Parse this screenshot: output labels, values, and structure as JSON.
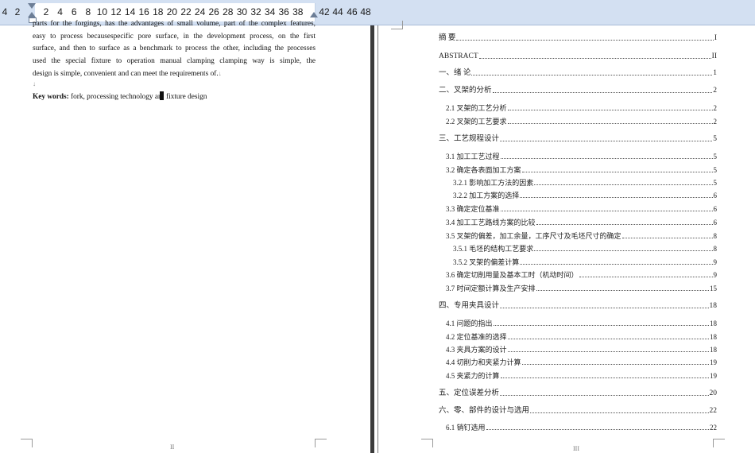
{
  "ruler": {
    "labels_left": [
      "4",
      "2"
    ],
    "labels": [
      "2",
      "4",
      "6",
      "8",
      "10",
      "12",
      "14",
      "16",
      "18",
      "20",
      "22",
      "24",
      "26",
      "28",
      "30",
      "32",
      "34",
      "36",
      "38"
    ],
    "labels_right": [
      "42",
      "44",
      "46",
      "48"
    ]
  },
  "left_page": {
    "abstract_lines": [
      "parts for the forgings, has the advantages of small volume, part of the complex features,",
      "easy to process becausespecific pore surface, in the development process, on the first",
      "surface, and then to surface as a benchmark to process the other, including the processes",
      "used the special fixture to operation manual clamping clamping way is simple, the",
      "design is simple, convenient and can meet the requirements of."
    ],
    "para_mark": "↓",
    "empty_mark": "↓",
    "keywords_label": "Key words:",
    "keywords_text_a": " fork, processing technology an",
    "keywords_text_b": " fixture design",
    "page_number": "II"
  },
  "right_page": {
    "page_number": "III",
    "toc": [
      {
        "title": "摘    要",
        "page": "I",
        "level": 1
      },
      {
        "title": "ABSTRACT",
        "page": "II",
        "level": 1
      },
      {
        "title": "一、绪  论",
        "page": "1",
        "level": 1
      },
      {
        "title": "二、叉架的分析",
        "page": "2",
        "level": 1
      },
      {
        "title": "2.1 叉架的工艺分析",
        "page": "2",
        "level": 2
      },
      {
        "title": "2.2 叉架的工艺要求",
        "page": "2",
        "level": 2
      },
      {
        "title": "三、工艺规程设计",
        "page": "5",
        "level": 1
      },
      {
        "title": "3.1 加工工艺过程",
        "page": "5",
        "level": 2
      },
      {
        "title": "3.2 确定各表面加工方案",
        "page": "5",
        "level": 2
      },
      {
        "title": "3.2.1 影响加工方法的因素",
        "page": "5",
        "level": 3
      },
      {
        "title": "3.2.2 加工方案的选择",
        "page": "6",
        "level": 3
      },
      {
        "title": "3.3 确定定位基准",
        "page": "6",
        "level": 2
      },
      {
        "title": "3.4 加工工艺路线方案的比较",
        "page": "6",
        "level": 2
      },
      {
        "title": "3.5 叉架的偏差，加工余量，工序尺寸及毛坯尺寸的确定",
        "page": "8",
        "level": 2
      },
      {
        "title": "3.5.1 毛坯的结构工艺要求",
        "page": "8",
        "level": 3
      },
      {
        "title": "3.5.2 叉架的偏差计算",
        "page": "9",
        "level": 3
      },
      {
        "title": "3.6 确定切削用量及基本工时（机动时间）",
        "page": "9",
        "level": 2
      },
      {
        "title": "3.7 时间定额计算及生产安排",
        "page": "15",
        "level": 2
      },
      {
        "title": "四、专用夹具设计",
        "page": "18",
        "level": 1
      },
      {
        "title": "4.1 问题的指出",
        "page": "18",
        "level": 2
      },
      {
        "title": "4.2 定位基准的选择",
        "page": "18",
        "level": 2
      },
      {
        "title": "4.3 夹具方案的设计",
        "page": "18",
        "level": 2
      },
      {
        "title": "4.4 切削力和夹紧力计算",
        "page": "19",
        "level": 2
      },
      {
        "title": "4.5 夹紧力的计算",
        "page": "19",
        "level": 2
      },
      {
        "title": "五、定位误差分析",
        "page": "20",
        "level": 1
      },
      {
        "title": "六、零、部件的设计与选用",
        "page": "22",
        "level": 1
      },
      {
        "title": "6.1 销钉选用",
        "page": "22",
        "level": 2
      }
    ]
  }
}
